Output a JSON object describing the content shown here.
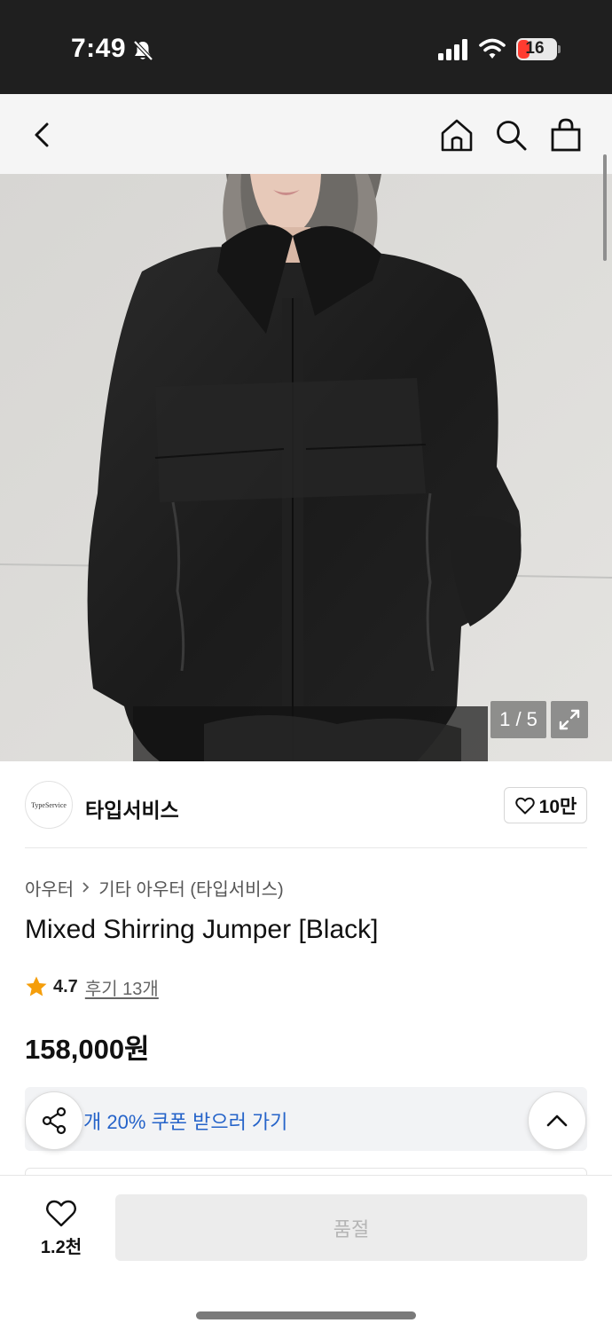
{
  "status_bar": {
    "time": "7:49",
    "battery": "16",
    "icons": [
      "bell-off-icon",
      "signal-icon",
      "wifi-icon",
      "battery-icon"
    ]
  },
  "nav": {
    "icons": [
      "back-icon",
      "home-icon",
      "search-icon",
      "cart-icon"
    ]
  },
  "gallery": {
    "counter": "1 / 5",
    "current": 1,
    "total": 5
  },
  "brand": {
    "logo_text": "TypeService",
    "name": "타입서비스",
    "like_count": "10만"
  },
  "product": {
    "breadcrumb": [
      "아우터",
      "기타 아우터 (타입서비스)"
    ],
    "title": "Mixed Shirring Jumper [Black]",
    "rating": "4.7",
    "reviews": "후기 13개",
    "price": "158,000원"
  },
  "coupon": {
    "text": "개 20% 쿠폰 받으러 가기"
  },
  "bottom_bar": {
    "wish_count": "1.2천",
    "soldout_label": "품절"
  },
  "colors": {
    "coupon_text": "#2563c9",
    "star": "#f59e0b",
    "status_bar_bg": "#1f1f1f"
  }
}
